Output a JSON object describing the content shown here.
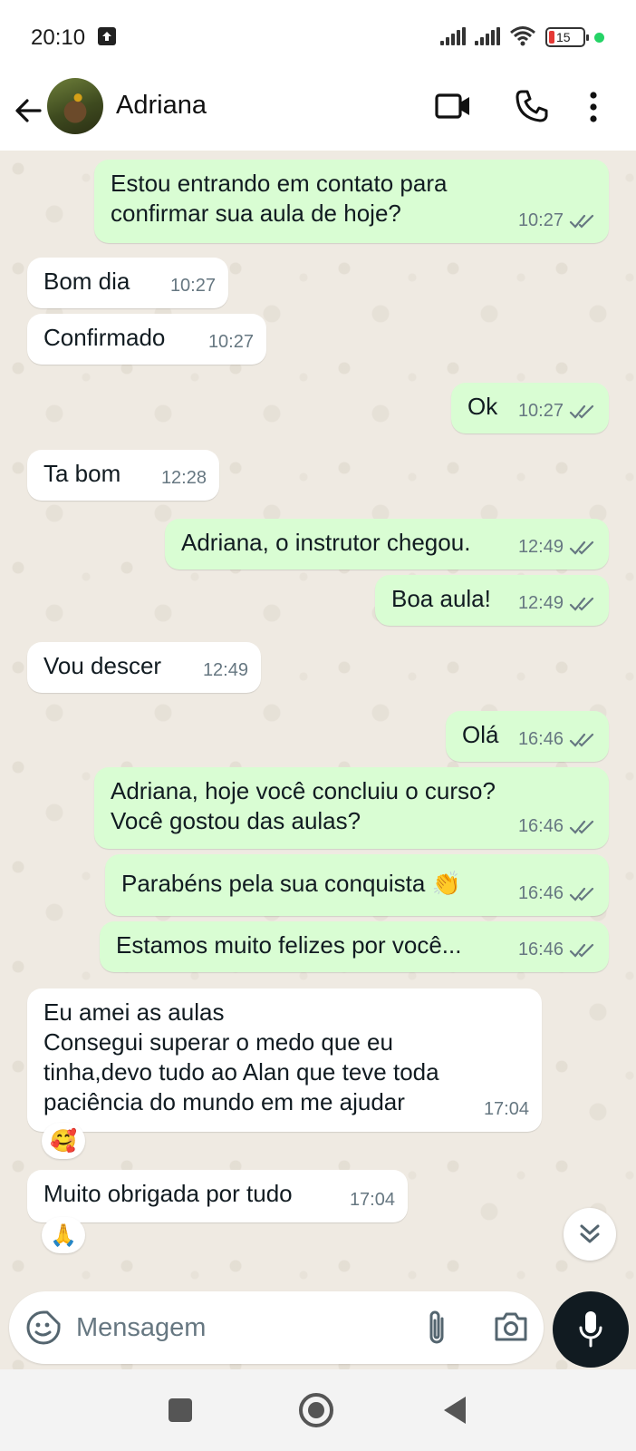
{
  "status_bar": {
    "time": "20:10",
    "battery_level": "15",
    "battery_percent": 15,
    "dot_color": "#25d366"
  },
  "header": {
    "contact_name": "Adriana",
    "icons": [
      "back-arrow-icon",
      "video-call-icon",
      "voice-call-icon",
      "more-options-icon"
    ]
  },
  "messages": [
    {
      "dir": "out",
      "text": "Estou entrando em contato para\nconfirmar sua aula de hoje?",
      "time": "10:27",
      "read": true
    },
    {
      "dir": "in",
      "text": "Bom dia",
      "time": "10:27"
    },
    {
      "dir": "in",
      "text": "Confirmado",
      "time": "10:27"
    },
    {
      "dir": "out",
      "text": "Ok",
      "time": "10:27",
      "read": true
    },
    {
      "dir": "in",
      "text": "Ta bom",
      "time": "12:28"
    },
    {
      "dir": "out",
      "text": "Adriana, o instrutor chegou.",
      "time": "12:49",
      "read": true
    },
    {
      "dir": "out",
      "text": "Boa aula!",
      "time": "12:49",
      "read": true
    },
    {
      "dir": "in",
      "text": "Vou descer",
      "time": "12:49"
    },
    {
      "dir": "out",
      "text": "Olá",
      "time": "16:46",
      "read": true
    },
    {
      "dir": "out",
      "text": "Adriana, hoje você concluiu o curso?\nVocê gostou das aulas?",
      "time": "16:46",
      "read": true
    },
    {
      "dir": "out",
      "text": "Parabéns pela sua conquista 👏",
      "time": "16:46",
      "read": true
    },
    {
      "dir": "out",
      "text": "Estamos muito felizes por você...",
      "time": "16:46",
      "read": true
    },
    {
      "dir": "in",
      "text": "Eu amei as aulas\nConsegui superar o medo que eu\ntinha,devo tudo ao Alan que teve toda\npaciência do mundo em me ajudar",
      "time": "17:04",
      "reaction": "🥰"
    },
    {
      "dir": "in",
      "text": "Muito obrigada por tudo",
      "time": "17:04",
      "reaction": "🙏"
    }
  ],
  "input": {
    "placeholder": "Mensagem"
  },
  "colors": {
    "outgoing_bubble": "#d9fdd3",
    "incoming_bubble": "#ffffff",
    "chat_background": "#efeae2",
    "read_ticks": "#53bdeb",
    "mic_button": "#111b21"
  }
}
